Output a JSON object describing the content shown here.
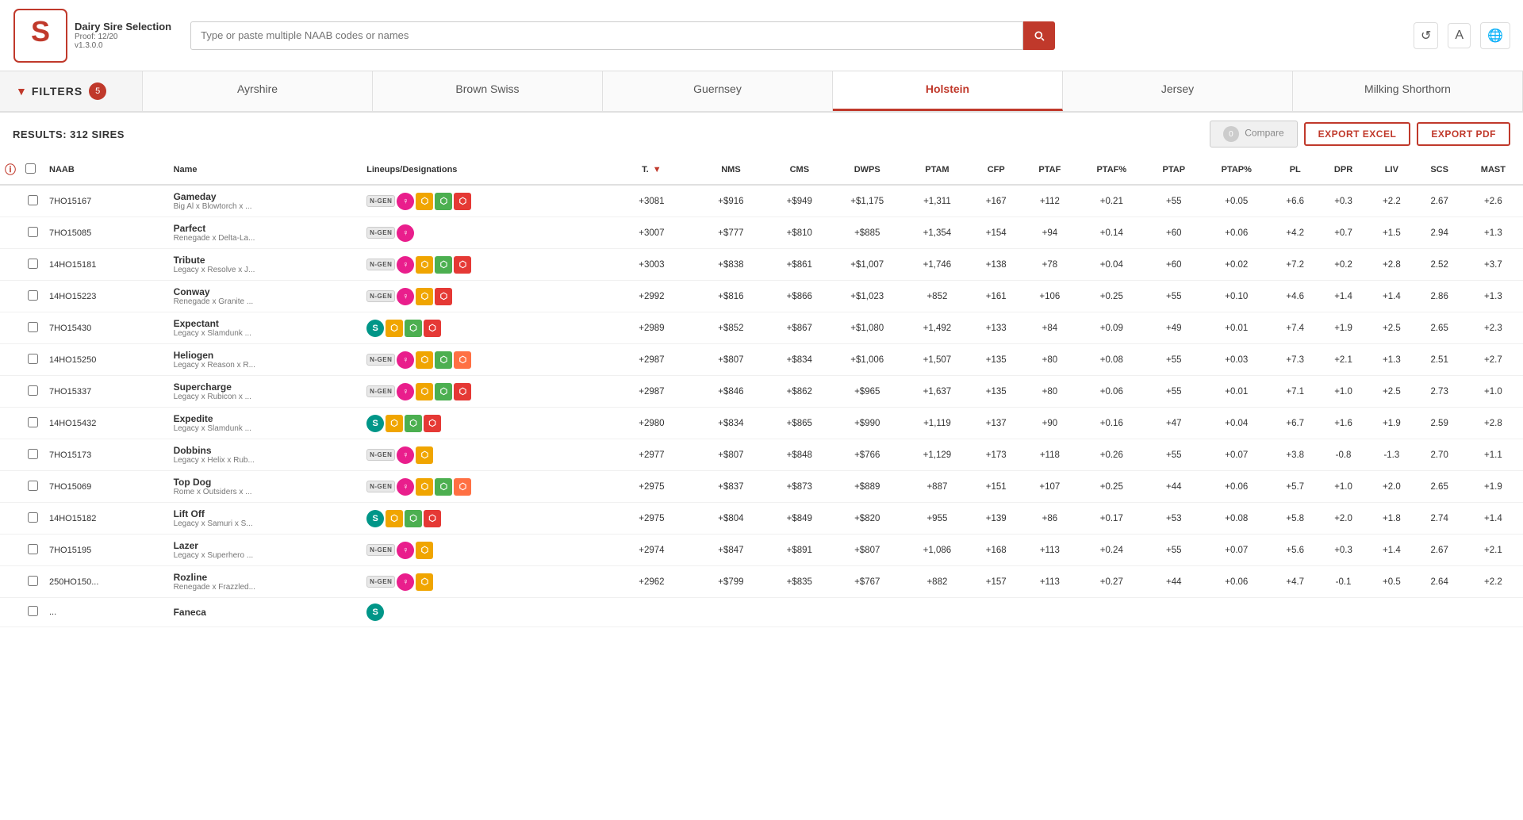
{
  "header": {
    "brand_name": "Dairy Sire Selection",
    "proof": "Proof: 12/20",
    "version": "v1.3.0.0",
    "search_placeholder": "Type or paste multiple NAAB codes or names"
  },
  "filters": {
    "label": "FILTERS",
    "count": "5"
  },
  "breeds": [
    {
      "id": "ayrshire",
      "label": "Ayrshire",
      "active": false
    },
    {
      "id": "brown-swiss",
      "label": "Brown Swiss",
      "active": false
    },
    {
      "id": "guernsey",
      "label": "Guernsey",
      "active": false
    },
    {
      "id": "holstein",
      "label": "Holstein",
      "active": true
    },
    {
      "id": "jersey",
      "label": "Jersey",
      "active": false
    },
    {
      "id": "milking-shorthorn",
      "label": "Milking Shorthorn",
      "active": false
    }
  ],
  "results": {
    "label": "RESULTS: 312 SIRES",
    "compare_label": "Compare",
    "export_excel": "EXPORT EXCEL",
    "export_pdf": "EXPORT PDF"
  },
  "columns": [
    "NAAB",
    "Name",
    "Lineups/Designations",
    "T.",
    "NMS",
    "CMS",
    "DWPS",
    "PTAM",
    "CFP",
    "PTAF",
    "PTAF%",
    "PTAP",
    "PTAP%",
    "PL",
    "DPR",
    "LIV",
    "SCS",
    "MAST"
  ],
  "sires": [
    {
      "naab": "7HO15167",
      "name": "Gameday",
      "lineage": "Big Al x Blowtorch x ...",
      "icons": [
        "ngen",
        "female",
        "grain",
        "leaf",
        "hex-red"
      ],
      "t": "+3081",
      "nms": "+$916",
      "cms": "+$949",
      "dwps": "+$1,175",
      "ptam": "+1,311",
      "cfp": "+167",
      "ptaf": "+112",
      "ptaf_pct": "+0.21",
      "ptap": "+55",
      "ptap_pct": "+0.05",
      "pl": "+6.6",
      "dpr": "+0.3",
      "liv": "+2.2",
      "scs": "2.67",
      "mast": "+2.6"
    },
    {
      "naab": "7HO15085",
      "name": "Parfect",
      "lineage": "Renegade x Delta-La...",
      "icons": [
        "ngen",
        "female"
      ],
      "t": "+3007",
      "nms": "+$777",
      "cms": "+$810",
      "dwps": "+$885",
      "ptam": "+1,354",
      "cfp": "+154",
      "ptaf": "+94",
      "ptaf_pct": "+0.14",
      "ptap": "+60",
      "ptap_pct": "+0.06",
      "pl": "+4.2",
      "dpr": "+0.7",
      "liv": "+1.5",
      "scs": "2.94",
      "mast": "+1.3"
    },
    {
      "naab": "14HO15181",
      "name": "Tribute",
      "lineage": "Legacy x Resolve x J...",
      "icons": [
        "ngen",
        "female",
        "grain",
        "leaf",
        "hex-red"
      ],
      "t": "+3003",
      "nms": "+$838",
      "cms": "+$861",
      "dwps": "+$1,007",
      "ptam": "+1,746",
      "cfp": "+138",
      "ptaf": "+78",
      "ptaf_pct": "+0.04",
      "ptap": "+60",
      "ptap_pct": "+0.02",
      "pl": "+7.2",
      "dpr": "+0.2",
      "liv": "+2.8",
      "scs": "2.52",
      "mast": "+3.7"
    },
    {
      "naab": "14HO15223",
      "name": "Conway",
      "lineage": "Renegade x Granite ...",
      "icons": [
        "ngen",
        "female",
        "grain",
        "hex-red"
      ],
      "t": "+2992",
      "nms": "+$816",
      "cms": "+$866",
      "dwps": "+$1,023",
      "ptam": "+852",
      "cfp": "+161",
      "ptaf": "+106",
      "ptaf_pct": "+0.25",
      "ptap": "+55",
      "ptap_pct": "+0.10",
      "pl": "+4.6",
      "dpr": "+1.4",
      "liv": "+1.4",
      "scs": "2.86",
      "mast": "+1.3"
    },
    {
      "naab": "7HO15430",
      "name": "Expectant",
      "lineage": "Legacy x Slamdunk ...",
      "icons": [
        "teal",
        "grain",
        "leaf",
        "hex-red"
      ],
      "t": "+2989",
      "nms": "+$852",
      "cms": "+$867",
      "dwps": "+$1,080",
      "ptam": "+1,492",
      "cfp": "+133",
      "ptaf": "+84",
      "ptaf_pct": "+0.09",
      "ptap": "+49",
      "ptap_pct": "+0.01",
      "pl": "+7.4",
      "dpr": "+1.9",
      "liv": "+2.5",
      "scs": "2.65",
      "mast": "+2.3"
    },
    {
      "naab": "14HO15250",
      "name": "Heliogen",
      "lineage": "Legacy x Reason x R...",
      "icons": [
        "ngen",
        "female",
        "grain",
        "leaf",
        "hex-orange"
      ],
      "t": "+2987",
      "nms": "+$807",
      "cms": "+$834",
      "dwps": "+$1,006",
      "ptam": "+1,507",
      "cfp": "+135",
      "ptaf": "+80",
      "ptaf_pct": "+0.08",
      "ptap": "+55",
      "ptap_pct": "+0.03",
      "pl": "+7.3",
      "dpr": "+2.1",
      "liv": "+1.3",
      "scs": "2.51",
      "mast": "+2.7"
    },
    {
      "naab": "7HO15337",
      "name": "Supercharge",
      "lineage": "Legacy x Rubicon x ...",
      "icons": [
        "ngen",
        "female",
        "grain",
        "leaf",
        "hex-red"
      ],
      "t": "+2987",
      "nms": "+$846",
      "cms": "+$862",
      "dwps": "+$965",
      "ptam": "+1,637",
      "cfp": "+135",
      "ptaf": "+80",
      "ptaf_pct": "+0.06",
      "ptap": "+55",
      "ptap_pct": "+0.01",
      "pl": "+7.1",
      "dpr": "+1.0",
      "liv": "+2.5",
      "scs": "2.73",
      "mast": "+1.0"
    },
    {
      "naab": "14HO15432",
      "name": "Expedite",
      "lineage": "Legacy x Slamdunk ...",
      "icons": [
        "teal",
        "grain",
        "leaf",
        "hex-red"
      ],
      "t": "+2980",
      "nms": "+$834",
      "cms": "+$865",
      "dwps": "+$990",
      "ptam": "+1,119",
      "cfp": "+137",
      "ptaf": "+90",
      "ptaf_pct": "+0.16",
      "ptap": "+47",
      "ptap_pct": "+0.04",
      "pl": "+6.7",
      "dpr": "+1.6",
      "liv": "+1.9",
      "scs": "2.59",
      "mast": "+2.8"
    },
    {
      "naab": "7HO15173",
      "name": "Dobbins",
      "lineage": "Legacy x Helix x Rub...",
      "icons": [
        "ngen",
        "female",
        "grain"
      ],
      "t": "+2977",
      "nms": "+$807",
      "cms": "+$848",
      "dwps": "+$766",
      "ptam": "+1,129",
      "cfp": "+173",
      "ptaf": "+118",
      "ptaf_pct": "+0.26",
      "ptap": "+55",
      "ptap_pct": "+0.07",
      "pl": "+3.8",
      "dpr": "-0.8",
      "liv": "-1.3",
      "scs": "2.70",
      "mast": "+1.1"
    },
    {
      "naab": "7HO15069",
      "name": "Top Dog",
      "lineage": "Rome x Outsiders x ...",
      "icons": [
        "ngen",
        "female",
        "grain",
        "leaf",
        "hex-orange"
      ],
      "t": "+2975",
      "nms": "+$837",
      "cms": "+$873",
      "dwps": "+$889",
      "ptam": "+887",
      "cfp": "+151",
      "ptaf": "+107",
      "ptaf_pct": "+0.25",
      "ptap": "+44",
      "ptap_pct": "+0.06",
      "pl": "+5.7",
      "dpr": "+1.0",
      "liv": "+2.0",
      "scs": "2.65",
      "mast": "+1.9"
    },
    {
      "naab": "14HO15182",
      "name": "Lift Off",
      "lineage": "Legacy x Samuri x S...",
      "icons": [
        "teal",
        "grain",
        "leaf",
        "hex-red"
      ],
      "t": "+2975",
      "nms": "+$804",
      "cms": "+$849",
      "dwps": "+$820",
      "ptam": "+955",
      "cfp": "+139",
      "ptaf": "+86",
      "ptaf_pct": "+0.17",
      "ptap": "+53",
      "ptap_pct": "+0.08",
      "pl": "+5.8",
      "dpr": "+2.0",
      "liv": "+1.8",
      "scs": "2.74",
      "mast": "+1.4"
    },
    {
      "naab": "7HO15195",
      "name": "Lazer",
      "lineage": "Legacy x Superhero ...",
      "icons": [
        "ngen",
        "female",
        "grain"
      ],
      "t": "+2974",
      "nms": "+$847",
      "cms": "+$891",
      "dwps": "+$807",
      "ptam": "+1,086",
      "cfp": "+168",
      "ptaf": "+113",
      "ptaf_pct": "+0.24",
      "ptap": "+55",
      "ptap_pct": "+0.07",
      "pl": "+5.6",
      "dpr": "+0.3",
      "liv": "+1.4",
      "scs": "2.67",
      "mast": "+2.1"
    },
    {
      "naab": "250HO150...",
      "name": "Rozline",
      "lineage": "Renegade x Frazzled...",
      "icons": [
        "ngen",
        "female",
        "grain"
      ],
      "t": "+2962",
      "nms": "+$799",
      "cms": "+$835",
      "dwps": "+$767",
      "ptam": "+882",
      "cfp": "+157",
      "ptaf": "+113",
      "ptaf_pct": "+0.27",
      "ptap": "+44",
      "ptap_pct": "+0.06",
      "pl": "+4.7",
      "dpr": "-0.1",
      "liv": "+0.5",
      "scs": "2.64",
      "mast": "+2.2"
    },
    {
      "naab": "...",
      "name": "Faneca",
      "lineage": "",
      "icons": [
        "teal"
      ],
      "t": "...",
      "nms": "...",
      "cms": "...",
      "dwps": "...",
      "ptam": "...",
      "cfp": "...",
      "ptaf": "...",
      "ptaf_pct": "...",
      "ptap": "...",
      "ptap_pct": "...",
      "pl": "...",
      "dpr": "...",
      "liv": "...",
      "scs": "...",
      "mast": "..."
    }
  ]
}
